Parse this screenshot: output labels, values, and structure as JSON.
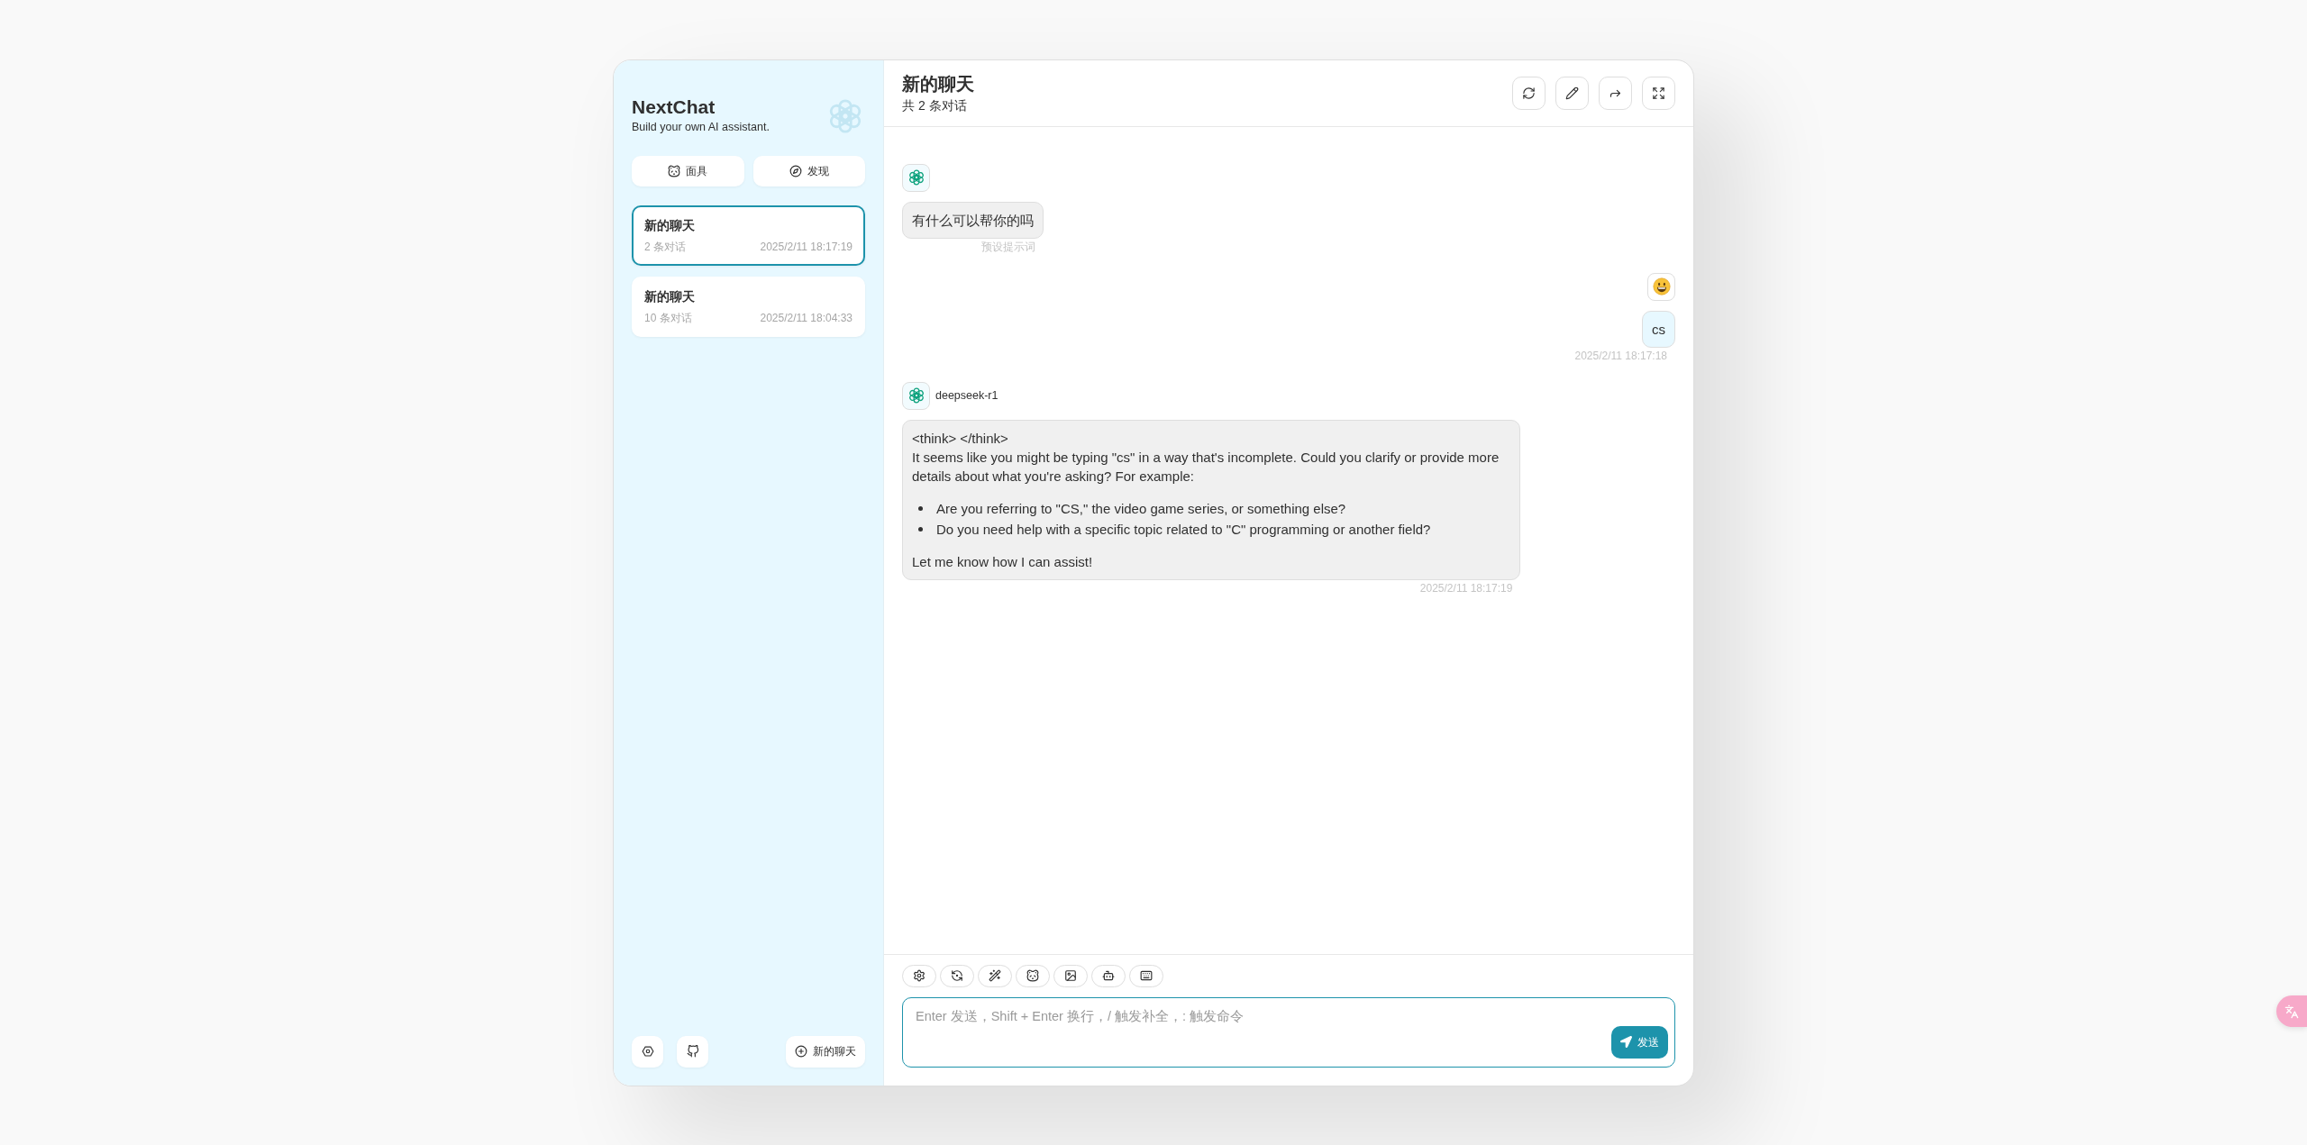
{
  "sidebar": {
    "title": "NextChat",
    "subtitle": "Build your own AI assistant.",
    "buttons": [
      {
        "label": "面具"
      },
      {
        "label": "发现"
      }
    ],
    "chats": [
      {
        "title": "新的聊天",
        "count": "2 条对话",
        "time": "2025/2/11 18:17:19",
        "selected": true
      },
      {
        "title": "新的聊天",
        "count": "10 条对话",
        "time": "2025/2/11 18:04:33",
        "selected": false
      }
    ],
    "new_chat": {
      "label": "新的聊天"
    }
  },
  "chat": {
    "title": "新的聊天",
    "subtitle": "共 2 条对话",
    "messages": [
      {
        "kind": "assistant",
        "blocks": [
          {
            "kind": "paragraph",
            "lines": [
              "有什么可以帮你的吗"
            ]
          }
        ],
        "footer": "预设提示词"
      },
      {
        "kind": "user",
        "blocks": [
          {
            "kind": "paragraph",
            "lines": [
              "cs"
            ]
          }
        ],
        "footer": "2025/2/11 18:17:18"
      },
      {
        "kind": "assistant",
        "model": "deepseek-r1",
        "blocks": [
          {
            "kind": "paragraph",
            "lines": [
              "<think> </think>",
              "It seems like you might be typing \"cs\" in a way that's incomplete. Could you clarify or provide more details about what you're asking? For example:"
            ]
          },
          {
            "kind": "list",
            "items": [
              "Are you referring to \"CS,\" the video game series, or something else?",
              "Do you need help with a specific topic related to \"C\" programming or another field?"
            ]
          },
          {
            "kind": "paragraph",
            "lines": [
              "Let me know how I can assist!"
            ]
          }
        ],
        "footer": "2025/2/11 18:17:19"
      }
    ]
  },
  "composer": {
    "placeholder": "Enter 发送，Shift + Enter 换行，/ 触发补全，: 触发命令",
    "send": {
      "label": "发送"
    }
  }
}
